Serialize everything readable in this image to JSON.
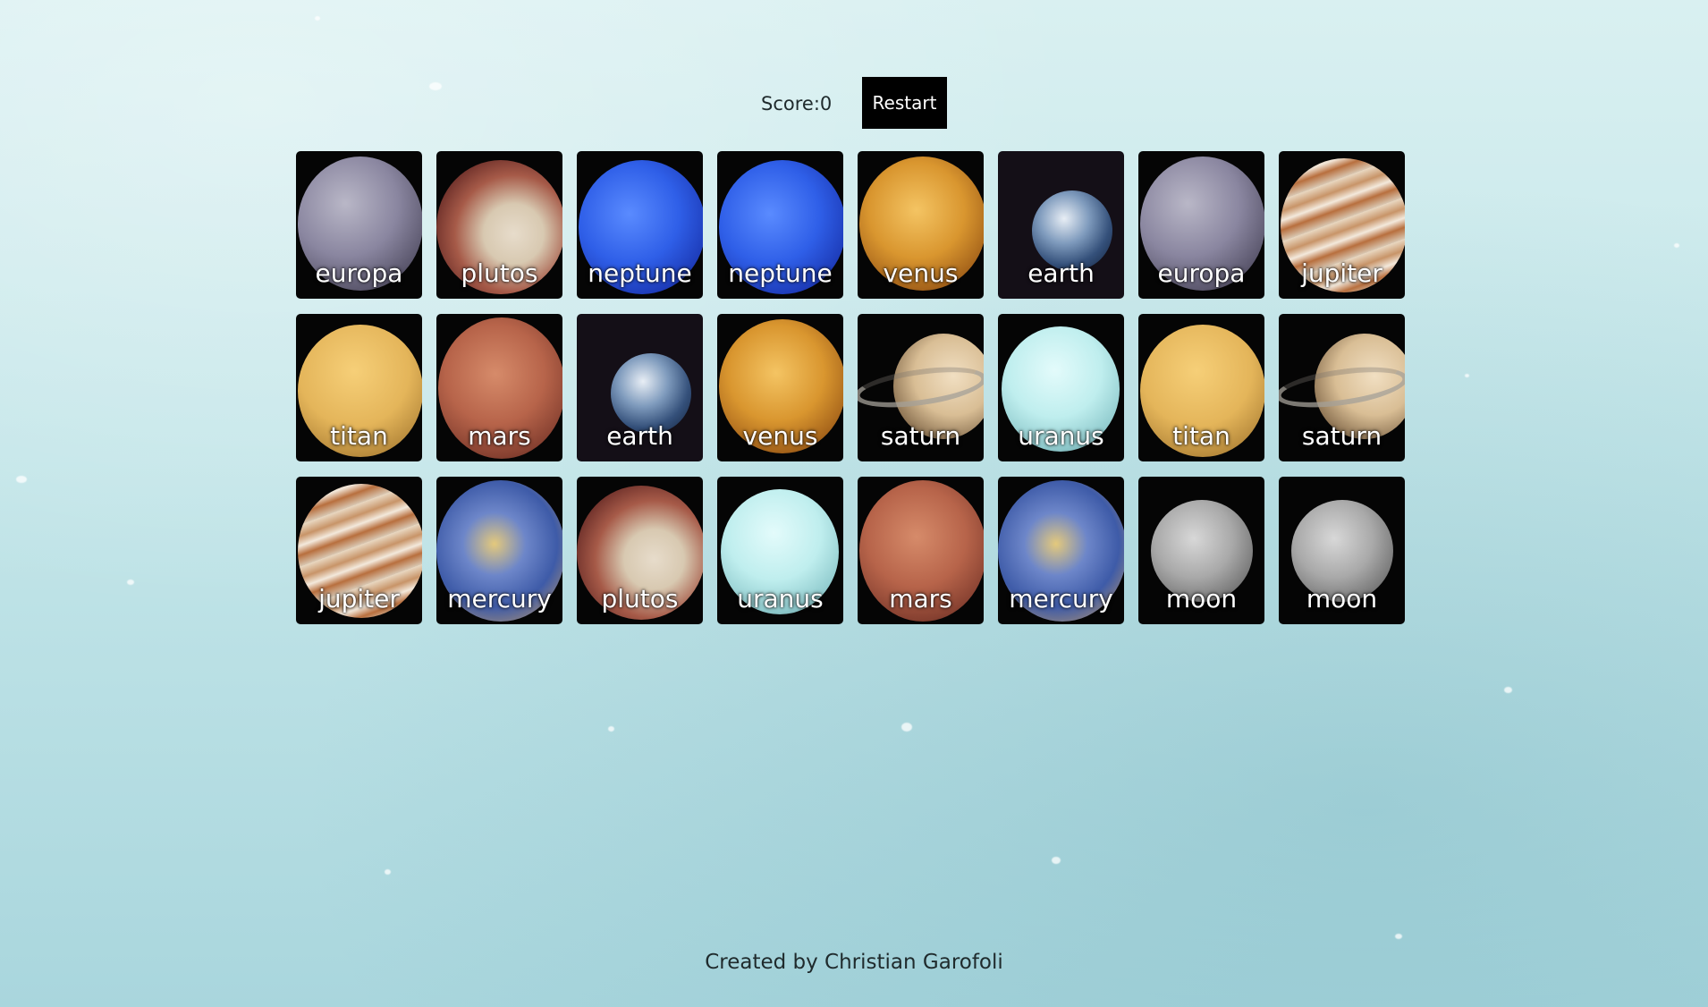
{
  "header": {
    "score_label": "Score:",
    "score_value": "0",
    "restart_label": "Restart"
  },
  "cards": [
    {
      "name": "europa"
    },
    {
      "name": "plutos"
    },
    {
      "name": "neptune"
    },
    {
      "name": "neptune"
    },
    {
      "name": "venus"
    },
    {
      "name": "earth"
    },
    {
      "name": "europa"
    },
    {
      "name": "jupiter"
    },
    {
      "name": "titan"
    },
    {
      "name": "mars"
    },
    {
      "name": "earth"
    },
    {
      "name": "venus"
    },
    {
      "name": "saturn"
    },
    {
      "name": "uranus"
    },
    {
      "name": "titan"
    },
    {
      "name": "saturn"
    },
    {
      "name": "jupiter"
    },
    {
      "name": "mercury"
    },
    {
      "name": "plutos"
    },
    {
      "name": "uranus"
    },
    {
      "name": "mars"
    },
    {
      "name": "mercury"
    },
    {
      "name": "moon"
    },
    {
      "name": "moon"
    }
  ],
  "footer": {
    "credit": "Created by Christian Garofoli"
  },
  "colors": {
    "background": "#c4e6e9",
    "card": "#050505",
    "button": "#000000",
    "text": "#1f2a2c"
  }
}
